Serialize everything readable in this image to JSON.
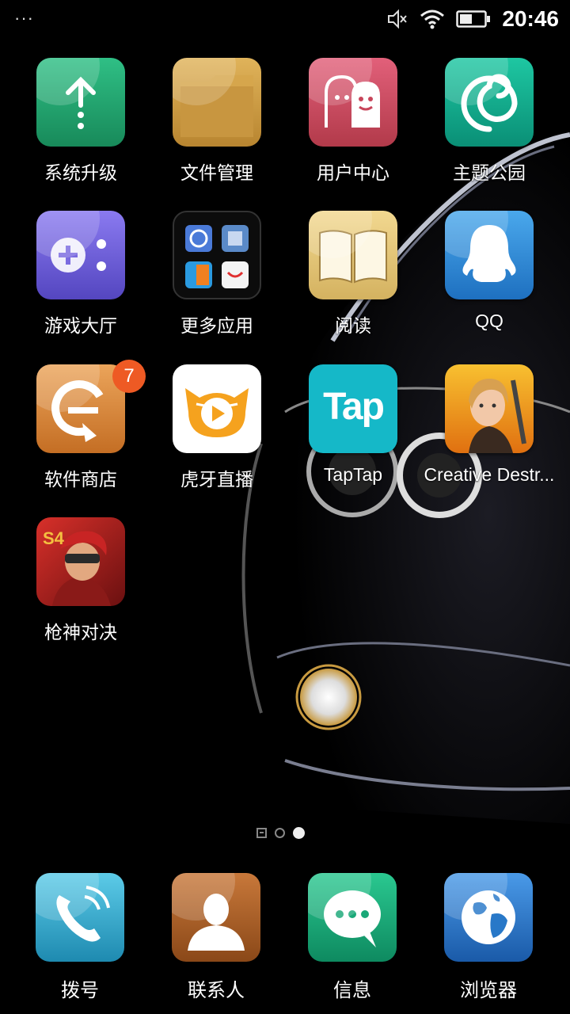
{
  "status": {
    "menu_dots": "···",
    "time": "20:46",
    "icons": [
      "mute-icon",
      "wifi-icon",
      "battery-icon"
    ]
  },
  "apps": [
    {
      "label": "系统升级",
      "icon": "system-update-icon",
      "color": "#1e9e6a"
    },
    {
      "label": "文件管理",
      "icon": "folder-icon",
      "color": "#c8963c"
    },
    {
      "label": "用户中心",
      "icon": "user-center-icon",
      "color": "#c8455a"
    },
    {
      "label": "主题公园",
      "icon": "theme-park-icon",
      "color": "#12a58a"
    },
    {
      "label": "游戏大厅",
      "icon": "game-hall-icon",
      "color": "#6a5ad8"
    },
    {
      "label": "更多应用",
      "icon": "app-folder-icon",
      "color": "#111111"
    },
    {
      "label": "阅读",
      "icon": "book-icon",
      "color": "#e8c979"
    },
    {
      "label": "QQ",
      "icon": "qq-penguin-icon",
      "color": "#2e8fd8"
    },
    {
      "label": "软件商店",
      "icon": "app-store-icon",
      "color": "#d8883a",
      "badge": "7"
    },
    {
      "label": "虎牙直播",
      "icon": "huya-tiger-icon",
      "color": "#ffffff"
    },
    {
      "label": "TapTap",
      "icon": "taptap-icon",
      "color": "#15b8c8",
      "logo_text": "Tap"
    },
    {
      "label": "Creative Destr...",
      "icon": "creative-destruction-icon",
      "color": "#f4a020"
    },
    {
      "label": "枪神对决",
      "icon": "gun-duel-icon",
      "color": "#b8201e"
    }
  ],
  "dock": [
    {
      "label": "拨号",
      "icon": "phone-icon",
      "color": "#2ea8c8"
    },
    {
      "label": "联系人",
      "icon": "contacts-icon",
      "color": "#b0602a"
    },
    {
      "label": "信息",
      "icon": "message-icon",
      "color": "#1aa878"
    },
    {
      "label": "浏览器",
      "icon": "browser-globe-icon",
      "color": "#2878c8"
    }
  ],
  "pager": {
    "pages": 2,
    "active": 2
  }
}
